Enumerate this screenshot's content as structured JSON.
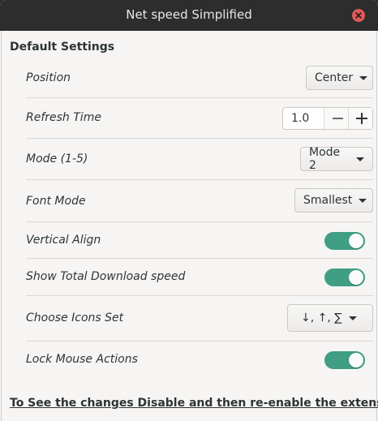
{
  "window": {
    "title": "Net speed Simplified"
  },
  "section": {
    "title": "Default Settings"
  },
  "settings": {
    "position": {
      "label": "Position",
      "value": "Center"
    },
    "refresh_time": {
      "label": "Refresh Time",
      "value": "1.0"
    },
    "mode": {
      "label": "Mode (1-5)",
      "value": "Mode 2"
    },
    "font_mode": {
      "label": "Font Mode",
      "value": "Smallest"
    },
    "vertical_align": {
      "label": "Vertical Align",
      "enabled": true
    },
    "show_total_download": {
      "label": "Show Total Download speed",
      "enabled": true
    },
    "icons_set": {
      "label": "Choose Icons Set",
      "value": "↓, ↑, ∑"
    },
    "lock_mouse": {
      "label": "Lock Mouse Actions",
      "enabled": true
    }
  },
  "footer": {
    "text": "To See the changes Disable and then re-enable the extension"
  },
  "colors": {
    "toggle_on": "#3f9e83",
    "titlebar": "#2d2d2d",
    "close": "#e05a5a"
  }
}
